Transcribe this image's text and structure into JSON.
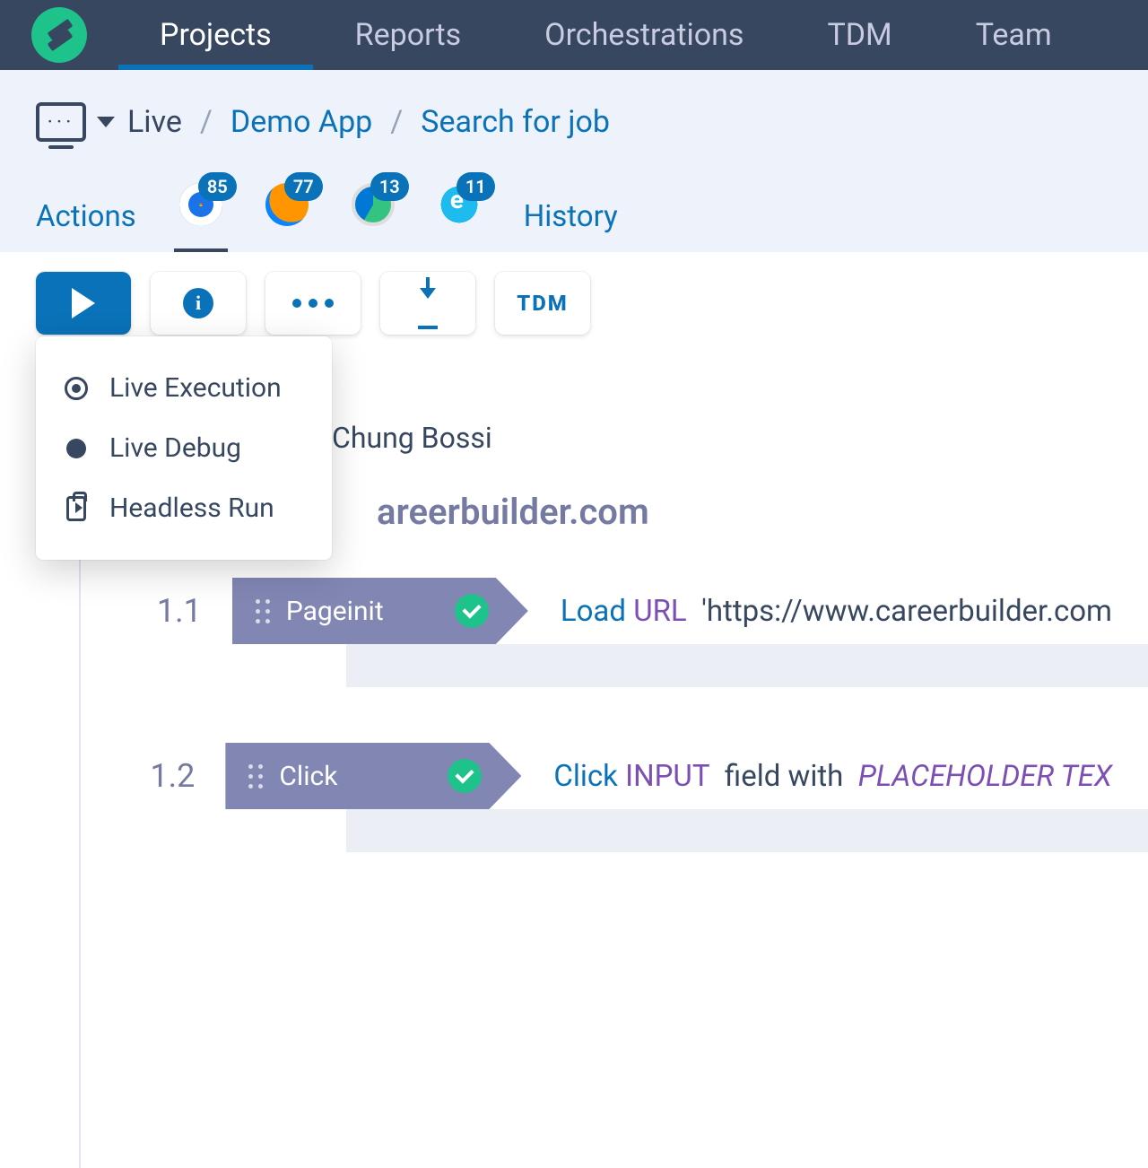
{
  "nav": {
    "items": [
      "Projects",
      "Reports",
      "Orchestrations",
      "TDM",
      "Team"
    ],
    "active": 0
  },
  "breadcrumb": {
    "live": "Live",
    "app": "Demo App",
    "test": "Search for job"
  },
  "tabs": {
    "actions": "Actions",
    "history": "History",
    "browsers": [
      {
        "name": "chrome",
        "count": 85,
        "active": true
      },
      {
        "name": "firefox",
        "count": 77,
        "active": false
      },
      {
        "name": "edge",
        "count": 13,
        "active": false
      },
      {
        "name": "ie",
        "count": 11,
        "active": false
      }
    ]
  },
  "toolbar": {
    "tdm_label": "TDM"
  },
  "dropdown": {
    "items": [
      {
        "label": "Live Execution"
      },
      {
        "label": "Live Debug"
      },
      {
        "label": "Headless Run"
      }
    ]
  },
  "author_fragment": "Chung Bossi",
  "case": {
    "title_fragment": "areerbuilder.com"
  },
  "steps": [
    {
      "num": "1.1",
      "chip": "Pageinit",
      "desc_parts": {
        "a": "Load",
        "b": "URL",
        "q": "'https://www.careerbuilder.com"
      }
    },
    {
      "num": "1.2",
      "chip": "Click",
      "desc_parts": {
        "a": "Click",
        "b": "INPUT",
        "c": "field with",
        "d": "PLACEHOLDER TEX"
      }
    }
  ]
}
